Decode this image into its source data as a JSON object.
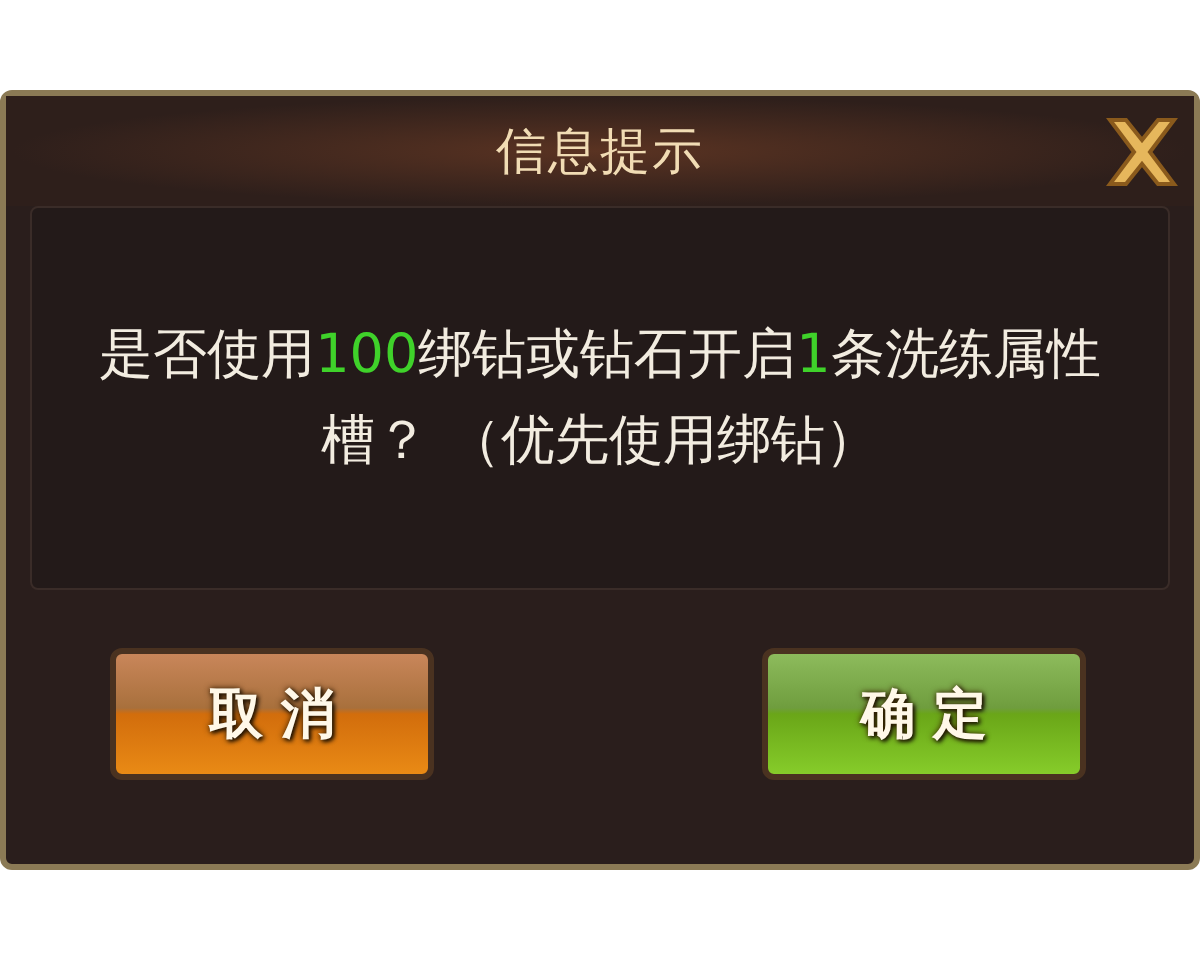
{
  "dialog": {
    "title": "信息提示",
    "message": [
      {
        "text": "是否使用",
        "highlight": false
      },
      {
        "text": "100",
        "highlight": true
      },
      {
        "text": "绑钻或钻石开启",
        "highlight": false
      },
      {
        "text": "1",
        "highlight": true
      },
      {
        "text": "条洗练属性槽？ （优先使用绑钻）",
        "highlight": false
      }
    ],
    "buttons": [
      {
        "label": "取 消",
        "kind": "cancel"
      },
      {
        "label": "确 定",
        "kind": "confirm"
      }
    ]
  }
}
